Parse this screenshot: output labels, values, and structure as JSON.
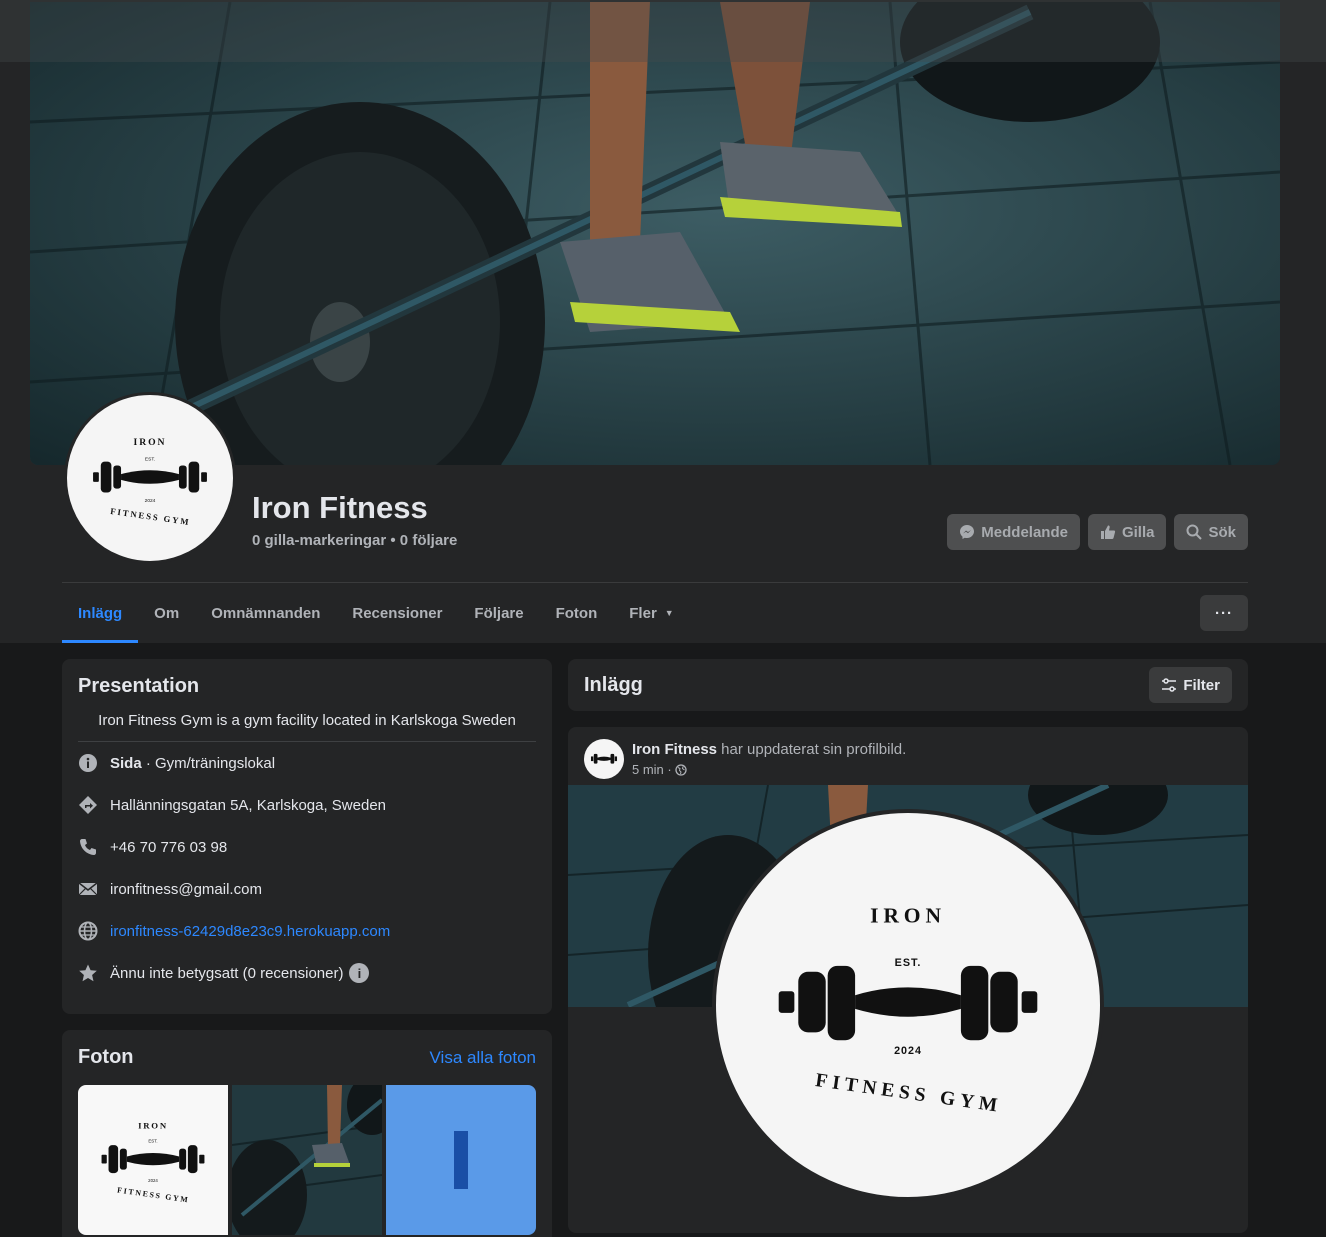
{
  "page": {
    "name": "Iron Fitness",
    "stats": "0 gilla-markeringar • 0 följare"
  },
  "logo": {
    "top_text": "IRON",
    "est": "EST.",
    "year": "2024",
    "bottom_text": "FITNESS GYM"
  },
  "header_buttons": {
    "message": "Meddelande",
    "like": "Gilla",
    "search": "Sök"
  },
  "tabs": [
    {
      "label": "Inlägg"
    },
    {
      "label": "Om"
    },
    {
      "label": "Omnämnanden"
    },
    {
      "label": "Recensioner"
    },
    {
      "label": "Följare"
    },
    {
      "label": "Foton"
    },
    {
      "label": "Fler"
    }
  ],
  "more_button": "···",
  "intro": {
    "title": "Presentation",
    "bio": "Iron Fitness Gym is a gym facility located in Karlskoga Sweden",
    "page_label": "Sida",
    "category": " · Gym/träningslokal",
    "address": "Hallänningsgatan 5A, Karlskoga, Sweden",
    "phone": "+46 70 776 03 98",
    "email": "ironfitness@gmail.com",
    "website": "ironfitness-62429d8e23c9.herokuapp.com",
    "rating": "Ännu inte betygsatt (0 recensioner)",
    "rating_info": "i"
  },
  "photos": {
    "title": "Foton",
    "see_all": "Visa alla foton"
  },
  "posts": {
    "title": "Inlägg",
    "filter": "Filter"
  },
  "post": {
    "author": "Iron Fitness",
    "action": " har uppdaterat sin profilbild.",
    "time": "5 min ·"
  },
  "colors": {
    "accent": "#2d88ff",
    "card": "#242526",
    "background": "#18191a"
  }
}
